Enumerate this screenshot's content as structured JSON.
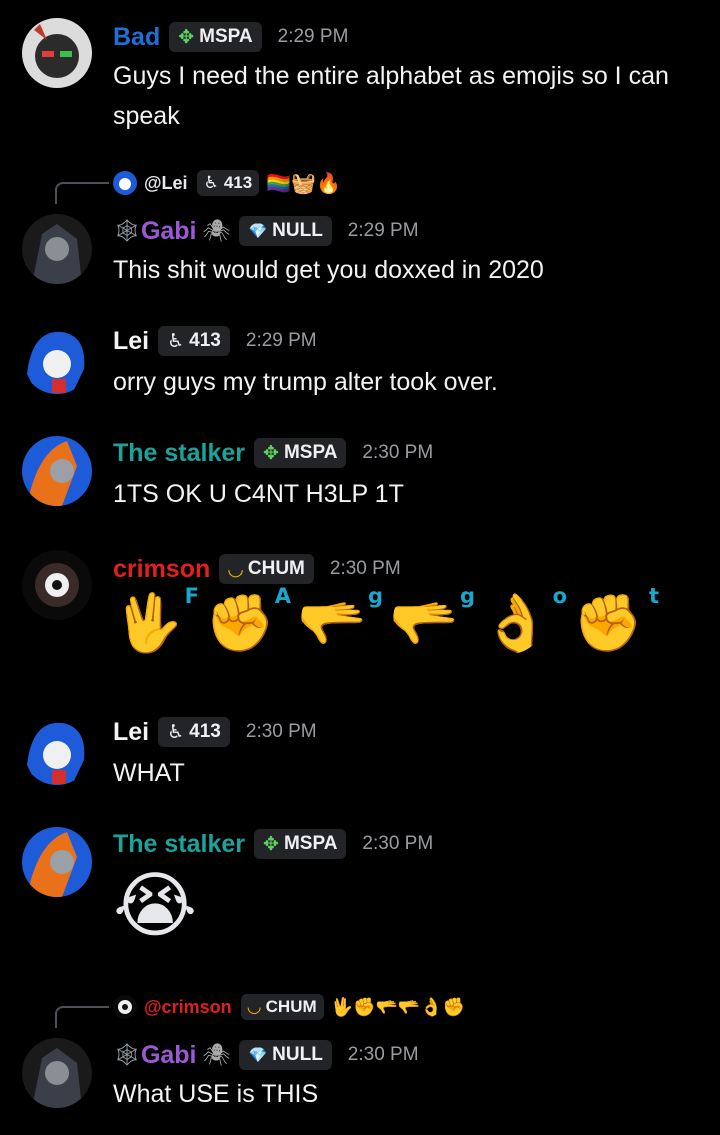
{
  "messages": [
    {
      "author": "Bad",
      "author_color": "#1e6fd9",
      "tag": "MSPA",
      "tag_icon": "✥",
      "time": "2:29 PM",
      "text": "Guys I need the entire alphabet as emojis so I can speak"
    },
    {
      "reply": {
        "mention": "@Lei",
        "tag": "413",
        "emojis": "🏳️‍🌈🧺🔥"
      },
      "author": "Gabi",
      "author_prefix": "🕸",
      "author_suffix": "🕷",
      "author_color": "#9b59d6",
      "tag": "NULL",
      "tag_icon": "💎",
      "time": "2:29 PM",
      "text": "This shit would get you doxxed in 2020"
    },
    {
      "author": "Lei",
      "author_color": "#f2f3f5",
      "tag": "413",
      "tag_icon": "♿",
      "time": "2:29 PM",
      "text": "orry guys my trump alter took over."
    },
    {
      "author": "The stalker",
      "author_color": "#1aa39a",
      "tag": "MSPA",
      "tag_icon": "✥",
      "time": "2:30 PM",
      "text": "1TS OK U C4NT H3LP 1T"
    },
    {
      "author": "crimson",
      "author_color": "#e02020",
      "tag": "CHUM",
      "tag_icon": "◡",
      "time": "2:30 PM",
      "signs": [
        {
          "hand": "🖖",
          "letter": "F"
        },
        {
          "hand": "✊",
          "letter": "A"
        },
        {
          "hand": "🫳",
          "letter": "g"
        },
        {
          "hand": "🫳",
          "letter": "g"
        },
        {
          "hand": "👌",
          "letter": "o"
        },
        {
          "hand": "✊",
          "letter": "t"
        }
      ]
    },
    {
      "author": "Lei",
      "author_color": "#f2f3f5",
      "tag": "413",
      "tag_icon": "♿",
      "time": "2:30 PM",
      "text": "WHAT"
    },
    {
      "author": "The stalker",
      "author_color": "#1aa39a",
      "tag": "MSPA",
      "tag_icon": "✥",
      "time": "2:30 PM",
      "emoji": "😭"
    },
    {
      "reply": {
        "mention": "@crimson",
        "mention_color": "#e02020",
        "tag": "CHUM",
        "tag_icon": "◡",
        "emojis": "🖖✊🫳🫳👌✊"
      },
      "author": "Gabi",
      "author_prefix": "🕸",
      "author_suffix": "🕷",
      "author_color": "#9b59d6",
      "tag": "NULL",
      "tag_icon": "💎",
      "time": "2:30 PM",
      "text": "What USE is THIS"
    }
  ]
}
